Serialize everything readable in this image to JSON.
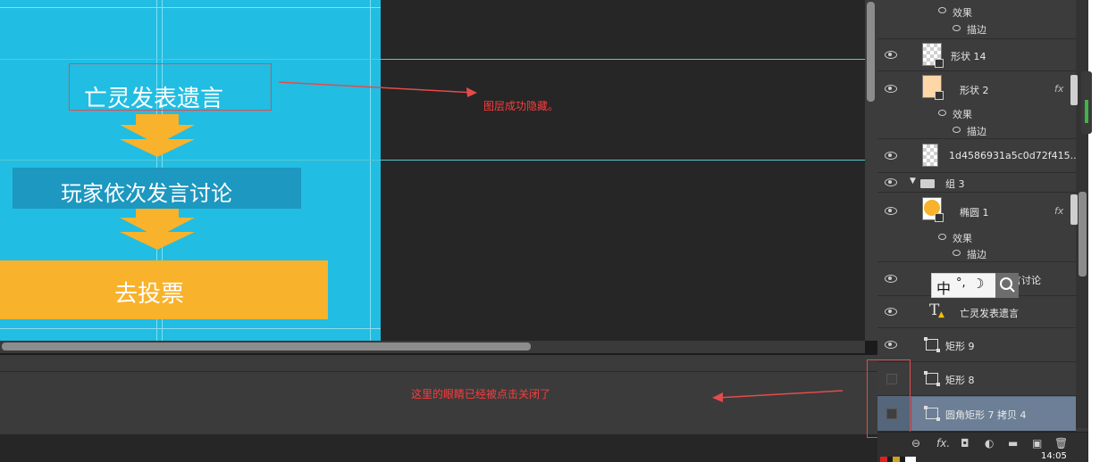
{
  "canvas": {
    "flow_step_1": "亡灵发表遗言",
    "flow_step_2": "玩家依次发言讨论",
    "flow_step_3": "去投票",
    "colors": {
      "background": "#22bde2",
      "accent": "#f8b22b",
      "dark_band": "#1d98c0"
    }
  },
  "annotations": {
    "hidden_note": "图层成功隐藏。",
    "eye_note": "这里的眼睛已经被点击关闭了"
  },
  "layers": {
    "effects_label": "效果",
    "stroke_label": "描边",
    "items": [
      {
        "name": "形状 14",
        "visible": true
      },
      {
        "name": "形状 2",
        "visible": true,
        "fx": "fx"
      },
      {
        "name": "1d4586931a5c0d72f415...",
        "visible": true
      },
      {
        "name": "组 3",
        "visible": true,
        "group": true
      },
      {
        "name": "椭圆 1",
        "visible": true,
        "fx": "fx"
      },
      {
        "name": "言讨论",
        "visible": true,
        "partially_hidden_by_ime": true
      },
      {
        "name": "亡灵发表遗言",
        "visible": true,
        "type": "text"
      },
      {
        "name": "矩形 9",
        "visible": true
      },
      {
        "name": "矩形 8",
        "visible": false
      },
      {
        "name": "圆角矩形 7 拷贝 4",
        "visible": false,
        "selected": true
      }
    ]
  },
  "ime": {
    "lang": "中",
    "punct": "°,",
    "mode": "☽"
  },
  "system": {
    "clock": "14:05"
  },
  "icons": [
    "eye-icon",
    "folder-icon",
    "text-layer-icon",
    "warning-icon",
    "shape-layer-icon",
    "link-icon",
    "fx-icon",
    "mask-icon",
    "adjustment-icon",
    "new-group-icon",
    "new-layer-icon",
    "trash-icon",
    "search-icon"
  ]
}
